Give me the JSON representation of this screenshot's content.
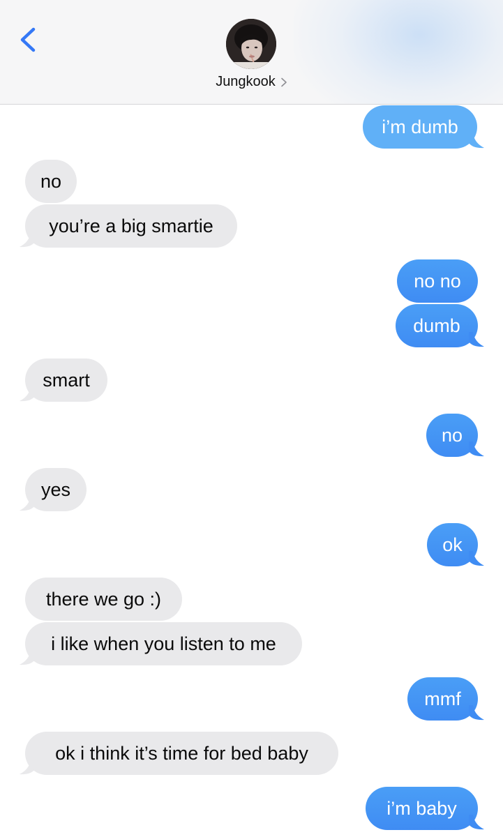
{
  "header": {
    "contact_name": "Jungkook",
    "icons": {
      "back": "chevron-left-icon",
      "disclosure": "chevron-right-icon",
      "avatar": "contact-avatar"
    },
    "accent_color": "#3478f6"
  },
  "messages": [
    {
      "text": "i’m dumb",
      "direction": "sent"
    },
    {
      "text": "no",
      "direction": "received"
    },
    {
      "text": "you’re a big smartie",
      "direction": "received"
    },
    {
      "text": "no no",
      "direction": "sent"
    },
    {
      "text": "dumb",
      "direction": "sent"
    },
    {
      "text": "smart",
      "direction": "received"
    },
    {
      "text": "no",
      "direction": "sent"
    },
    {
      "text": "yes",
      "direction": "received"
    },
    {
      "text": "ok",
      "direction": "sent"
    },
    {
      "text": "there we go :)",
      "direction": "received"
    },
    {
      "text": "i like when you listen to me",
      "direction": "received"
    },
    {
      "text": "mmf",
      "direction": "sent"
    },
    {
      "text": "ok i think it’s time for bed baby",
      "direction": "received"
    },
    {
      "text": "i’m baby",
      "direction": "sent"
    }
  ],
  "colors": {
    "sent_bubble": "#3f8cf3",
    "received_bubble": "#e9e9eb",
    "sent_text": "#ffffff",
    "received_text": "#0a0a0a"
  }
}
